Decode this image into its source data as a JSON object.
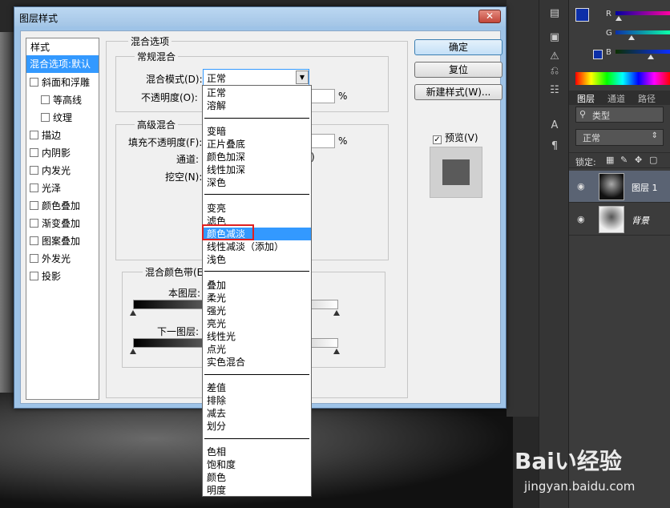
{
  "dialog": {
    "title": "图层样式",
    "close": "✕"
  },
  "style_list": {
    "header": "样式",
    "items": [
      "混合选项:默认",
      "斜面和浮雕",
      "等高线",
      "纹理",
      "描边",
      "内阴影",
      "内发光",
      "光泽",
      "颜色叠加",
      "渐变叠加",
      "图案叠加",
      "外发光",
      "投影"
    ]
  },
  "blend_options": {
    "section_title": "混合选项",
    "general_title": "常规混合",
    "mode_label": "混合模式(D):",
    "mode_value": "正常",
    "opacity_label": "不透明度(O):",
    "percent": "%",
    "advanced_title": "高级混合",
    "fill_opacity_label": "填充不透明度(F):",
    "channels_label": "通道:",
    "knockout_label": "挖空(N):",
    "blend_if_title": "混合颜色带(E",
    "this_layer_label": "本图层:",
    "underlying_label": "下一图层:"
  },
  "buttons": {
    "ok": "确定",
    "reset": "复位",
    "new_style": "新建样式(W)...",
    "preview": "预览(V)"
  },
  "dropdown": {
    "groups": [
      [
        "正常",
        "溶解"
      ],
      [
        "变暗",
        "正片叠底",
        "颜色加深",
        "线性加深",
        "深色"
      ],
      [
        "变亮",
        "滤色",
        "颜色减淡",
        "线性减淡（添加）",
        "浅色"
      ],
      [
        "叠加",
        "柔光",
        "强光",
        "亮光",
        "线性光",
        "点光",
        "实色混合"
      ],
      [
        "差值",
        "排除",
        "减去",
        "划分"
      ],
      [
        "色相",
        "饱和度",
        "颜色",
        "明度"
      ]
    ],
    "highlighted": "颜色减淡"
  },
  "right_panel": {
    "color_labels": [
      "R",
      "G",
      "B"
    ],
    "tabs": [
      "图层",
      "通道",
      "路径"
    ],
    "kind_filter": "类型",
    "blend_mode": "正常",
    "lock_label": "锁定:",
    "layers": [
      {
        "name": "图层 1",
        "selected": true
      },
      {
        "name": "背景",
        "selected": false
      }
    ]
  },
  "watermark": {
    "text": "Baiい经验",
    "url": "jingyan.baidu.com"
  }
}
